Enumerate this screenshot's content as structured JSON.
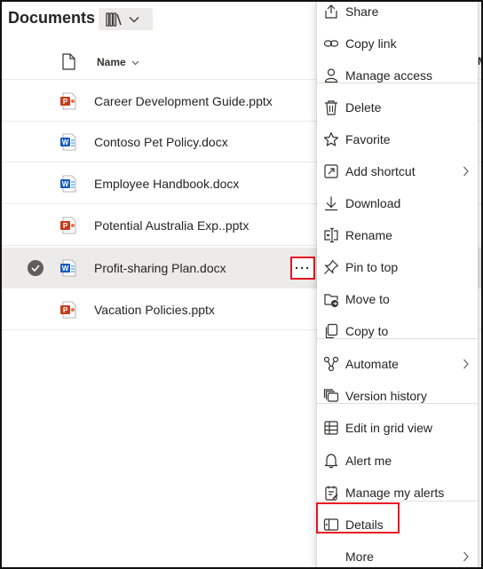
{
  "header": {
    "title": "Documents",
    "view_icon": "library-icon",
    "view_dropdown_icon": "chevron-down-icon"
  },
  "columns": {
    "file_type_icon": "document-icon",
    "name_label": "Name",
    "next_label": "M"
  },
  "files": [
    {
      "name": "Career Development Guide.pptx",
      "type": "pptx",
      "selected": false
    },
    {
      "name": "Contoso Pet Policy.docx",
      "type": "docx",
      "selected": false
    },
    {
      "name": "Employee Handbook.docx",
      "type": "docx",
      "selected": false
    },
    {
      "name": "Potential Australia Exp..pptx",
      "type": "pptx",
      "selected": false
    },
    {
      "name": "Profit-sharing Plan.docx",
      "type": "docx",
      "selected": true
    },
    {
      "name": "Vacation Policies.pptx",
      "type": "pptx",
      "selected": false
    }
  ],
  "row_more_label": "···",
  "menu": {
    "items": [
      {
        "label": "Share",
        "icon": "share-icon"
      },
      {
        "label": "Copy link",
        "icon": "link-icon"
      },
      {
        "label": "Manage access",
        "icon": "person-icon"
      },
      {
        "label": "Delete",
        "icon": "trash-icon"
      },
      {
        "label": "Favorite",
        "icon": "star-icon"
      },
      {
        "label": "Add shortcut",
        "icon": "shortcut-icon",
        "submenu": true
      },
      {
        "label": "Download",
        "icon": "download-icon"
      },
      {
        "label": "Rename",
        "icon": "rename-icon"
      },
      {
        "label": "Pin to top",
        "icon": "pin-icon"
      },
      {
        "label": "Move to",
        "icon": "move-icon"
      },
      {
        "label": "Copy to",
        "icon": "copy-icon"
      },
      {
        "label": "Automate",
        "icon": "automate-icon",
        "submenu": true
      },
      {
        "label": "Version history",
        "icon": "version-history-icon"
      },
      {
        "label": "Edit in grid view",
        "icon": "grid-icon"
      },
      {
        "label": "Alert me",
        "icon": "bell-icon"
      },
      {
        "label": "Manage my alerts",
        "icon": "manage-alerts-icon"
      },
      {
        "label": "Details",
        "icon": "details-icon"
      },
      {
        "label": "More",
        "icon": "",
        "submenu": true
      }
    ]
  },
  "colors": {
    "ppt_red": "#c43e1c",
    "word_blue": "#185abd",
    "highlight_red": "#e81123",
    "selected_row": "#edebe9"
  }
}
